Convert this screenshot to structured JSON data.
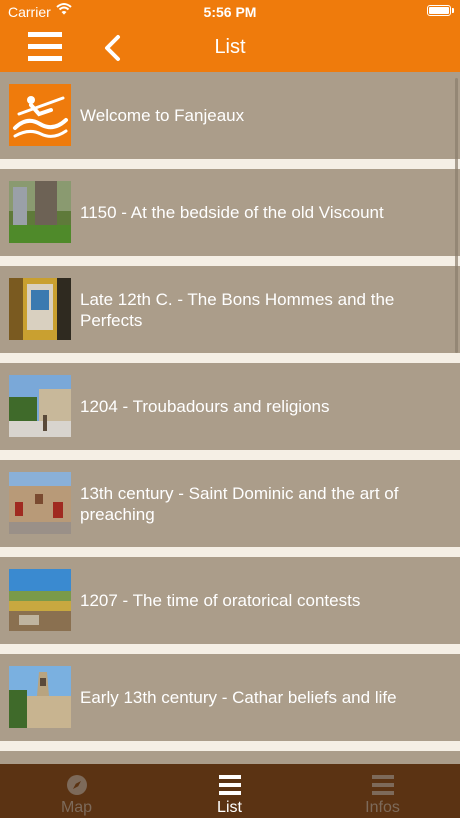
{
  "status_bar": {
    "carrier": "Carrier",
    "time": "5:56 PM",
    "battery_level": 1.0
  },
  "nav": {
    "title": "List",
    "menu_icon": "hamburger-icon",
    "back_icon": "chevron-left-icon"
  },
  "colors": {
    "accent": "#ef7b0c",
    "row_bg": "#ab9d8a",
    "separator": "#f5efe5",
    "tabbar_bg": "#5b3313",
    "tab_active": "#ffffff",
    "tab_inactive": "#7d6a5a"
  },
  "items": [
    {
      "title": "Welcome to Fanjeaux",
      "thumb": "logo"
    },
    {
      "title": "1150 - At the bedside of the old Viscount",
      "thumb": "tree"
    },
    {
      "title": "Late 12th C. - The Bons Hommes and the Perfects",
      "thumb": "sign"
    },
    {
      "title": "1204 - Troubadours and religions",
      "thumb": "square"
    },
    {
      "title": "13th century - Saint Dominic and the art of preaching",
      "thumb": "house"
    },
    {
      "title": "1207 - The time of oratorical contests",
      "thumb": "landscape"
    },
    {
      "title": "Early 13th century - Cathar beliefs and life",
      "thumb": "church"
    }
  ],
  "tabs": [
    {
      "label": "Map",
      "icon": "compass-icon",
      "active": false
    },
    {
      "label": "List",
      "icon": "list-icon",
      "active": true
    },
    {
      "label": "Infos",
      "icon": "info-list-icon",
      "active": false
    }
  ]
}
